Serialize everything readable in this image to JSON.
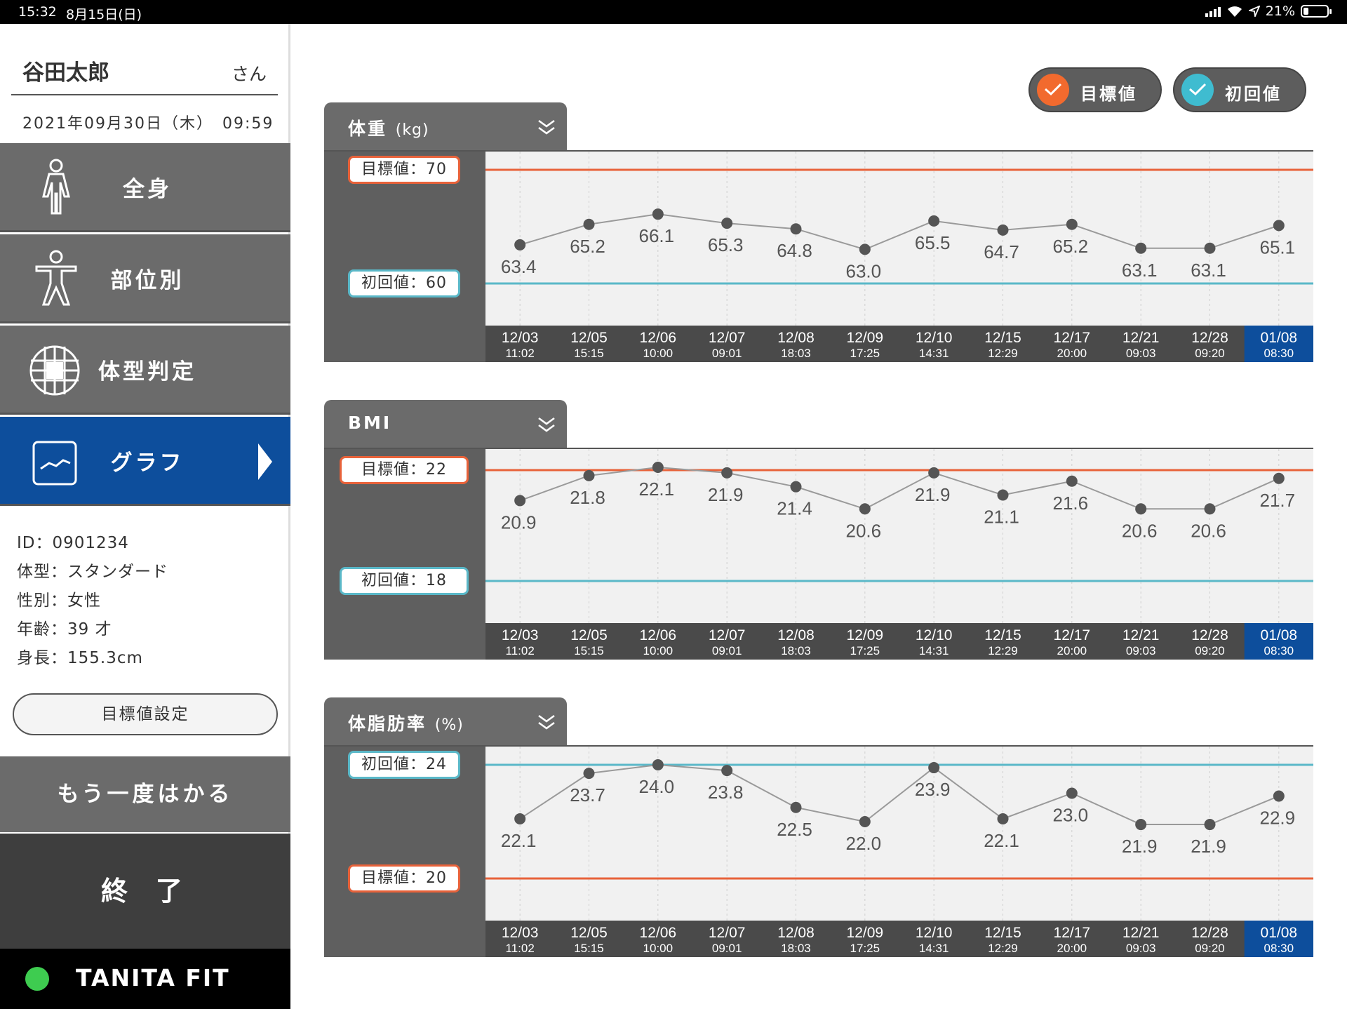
{
  "status": {
    "time": "15:32",
    "date": "8月15日(日)",
    "battery": "21%",
    "battery_level": 0.21
  },
  "sidebar": {
    "user_name": "谷田太郎",
    "honorific": "さん",
    "datetime": "2021年09月30日（木）　09:59",
    "menu": [
      {
        "label": "全身",
        "icon": "full-body-icon"
      },
      {
        "label": "部位別",
        "icon": "body-parts-icon"
      },
      {
        "label": "体型判定",
        "icon": "body-type-grid-icon"
      },
      {
        "label": "グラフ",
        "icon": "graph-icon"
      }
    ],
    "active_menu": 3,
    "info": {
      "id": "ID：0901234",
      "body_type": "体型：スタンダード",
      "sex": "性別：女性",
      "age": "年齢：39 才",
      "height": "身長：155.3cm"
    },
    "goal_setting_label": "目標値設定",
    "remeasure_label": "もう一度はかる",
    "finish_label": "終了",
    "brand": "TANITA FIT"
  },
  "toggles": {
    "goal": {
      "label": "目標値",
      "color": "#f26a2e"
    },
    "initial": {
      "label": "初回値",
      "color": "#3fbcd0"
    }
  },
  "colors": {
    "goal_line": "#e8623a",
    "initial_line": "#5ab8c8",
    "active_date": "#0d4e9c"
  },
  "dates": [
    {
      "date": "12/03",
      "time": "11:02"
    },
    {
      "date": "12/05",
      "time": "15:15"
    },
    {
      "date": "12/06",
      "time": "10:00"
    },
    {
      "date": "12/07",
      "time": "09:01"
    },
    {
      "date": "12/08",
      "time": "18:03"
    },
    {
      "date": "12/09",
      "time": "17:25"
    },
    {
      "date": "12/10",
      "time": "14:31"
    },
    {
      "date": "12/15",
      "time": "12:29"
    },
    {
      "date": "12/17",
      "time": "20:00"
    },
    {
      "date": "12/21",
      "time": "09:03"
    },
    {
      "date": "12/28",
      "time": "09:20"
    },
    {
      "date": "01/08",
      "time": "08:30"
    }
  ],
  "active_date_index": 11,
  "chart_data": [
    {
      "type": "line",
      "title": "体重",
      "unit": "(kg)",
      "values": [
        63.4,
        65.2,
        66.1,
        65.3,
        64.8,
        63.0,
        65.5,
        64.7,
        65.2,
        63.1,
        63.1,
        65.1
      ],
      "labels": [
        "63.4",
        "65.2",
        "66.1",
        "65.3",
        "64.8",
        "63.0",
        "65.5",
        "64.7",
        "65.2",
        "63.1",
        "63.1",
        "65.1"
      ],
      "goal": 70,
      "initial": 60,
      "goal_label": "目標値：70",
      "initial_label": "初回値：60"
    },
    {
      "type": "line",
      "title": "BMI",
      "unit": "",
      "values": [
        20.9,
        21.8,
        22.1,
        21.9,
        21.4,
        20.6,
        21.9,
        21.1,
        21.6,
        20.6,
        20.6,
        21.7
      ],
      "labels": [
        "20.9",
        "21.8",
        "22.1",
        "21.9",
        "21.4",
        "20.6",
        "21.9",
        "21.1",
        "21.6",
        "20.6",
        "20.6",
        "21.7"
      ],
      "goal": 22,
      "initial": 18,
      "goal_label": "目標値：22",
      "initial_label": "初回値：18"
    },
    {
      "type": "line",
      "title": "体脂肪率",
      "unit": "(%)",
      "values": [
        22.1,
        23.7,
        24.0,
        23.8,
        22.5,
        22.0,
        23.9,
        22.1,
        23.0,
        21.9,
        21.9,
        22.9
      ],
      "labels": [
        "22.1",
        "23.7",
        "24.0",
        "23.8",
        "22.5",
        "22.0",
        "23.9",
        "22.1",
        "23.0",
        "21.9",
        "21.9",
        "22.9"
      ],
      "goal": 20,
      "initial": 24,
      "goal_label": "目標値：20",
      "initial_label": "初回値：24"
    }
  ]
}
